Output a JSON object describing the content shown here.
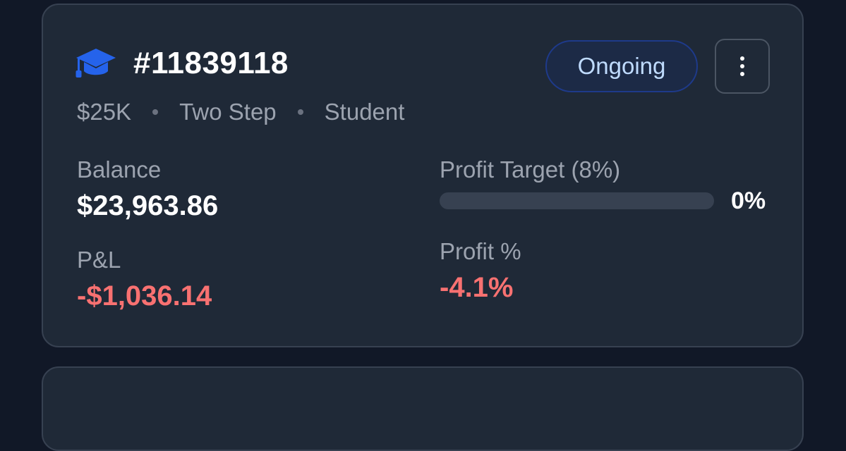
{
  "account": {
    "id": "#11839118",
    "icon": "graduation-cap-icon",
    "icon_color": "#2563eb",
    "status": "Ongoing",
    "meta": [
      "$25K",
      "Two Step",
      "Student"
    ]
  },
  "stats": {
    "balance_label": "Balance",
    "balance_value": "$23,963.86",
    "pnl_label": "P&L",
    "pnl_value": "-$1,036.14",
    "profit_target_label": "Profit Target (8%)",
    "profit_target_progress": 0,
    "profit_target_pct": "0%",
    "profit_pct_label": "Profit %",
    "profit_pct_value": "-4.1%"
  },
  "colors": {
    "negative": "#f87171",
    "status_text": "#bfdbfe",
    "card_bg": "#1f2937",
    "page_bg": "#111827"
  }
}
